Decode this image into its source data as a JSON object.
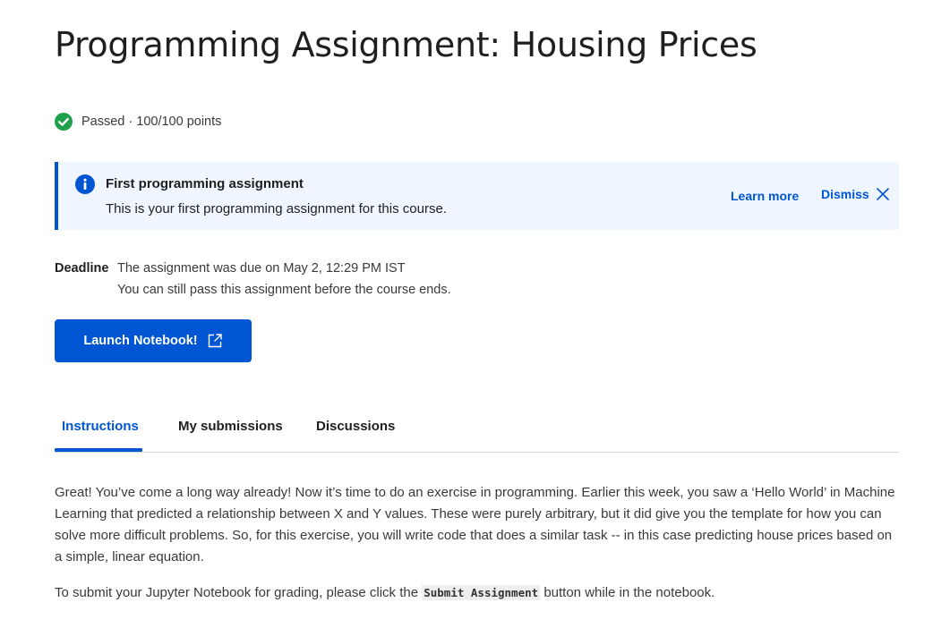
{
  "page": {
    "title": "Programming Assignment: Housing Prices",
    "status": {
      "icon": "check-circle-icon",
      "text": "Passed · 100/100 points",
      "color": "#1fa04b"
    }
  },
  "banner": {
    "icon": "info-icon",
    "title": "First programming assignment",
    "text": "This is your first programming assignment for this course.",
    "learn_more": "Learn more",
    "dismiss": "Dismiss",
    "accent": "#0056d2"
  },
  "deadline": {
    "label": "Deadline",
    "line1": "The assignment was due on May 2, 12:29 PM IST",
    "line2": "You can still pass this assignment before the course ends."
  },
  "launch": {
    "label": "Launch Notebook!",
    "icon": "external-link-icon"
  },
  "tabs": [
    {
      "label": "Instructions",
      "active": true
    },
    {
      "label": "My submissions",
      "active": false
    },
    {
      "label": "Discussions",
      "active": false
    }
  ],
  "instructions": {
    "paragraph1": "Great! You’ve come a long way already! Now it’s time to do an exercise in programming. Earlier this week, you saw a ‘Hello World’ in Machine Learning that predicted a relationship between X and Y values. These were purely arbitrary, but it did give you the template for how you can solve more difficult problems. So, for this exercise, you will write code that does a similar task -- in this case predicting house prices based on a simple, linear equation.",
    "paragraph2_before": "To submit your Jupyter Notebook for grading, please click the ",
    "paragraph2_code": "Submit Assignment",
    "paragraph2_after": " button while in the notebook."
  }
}
